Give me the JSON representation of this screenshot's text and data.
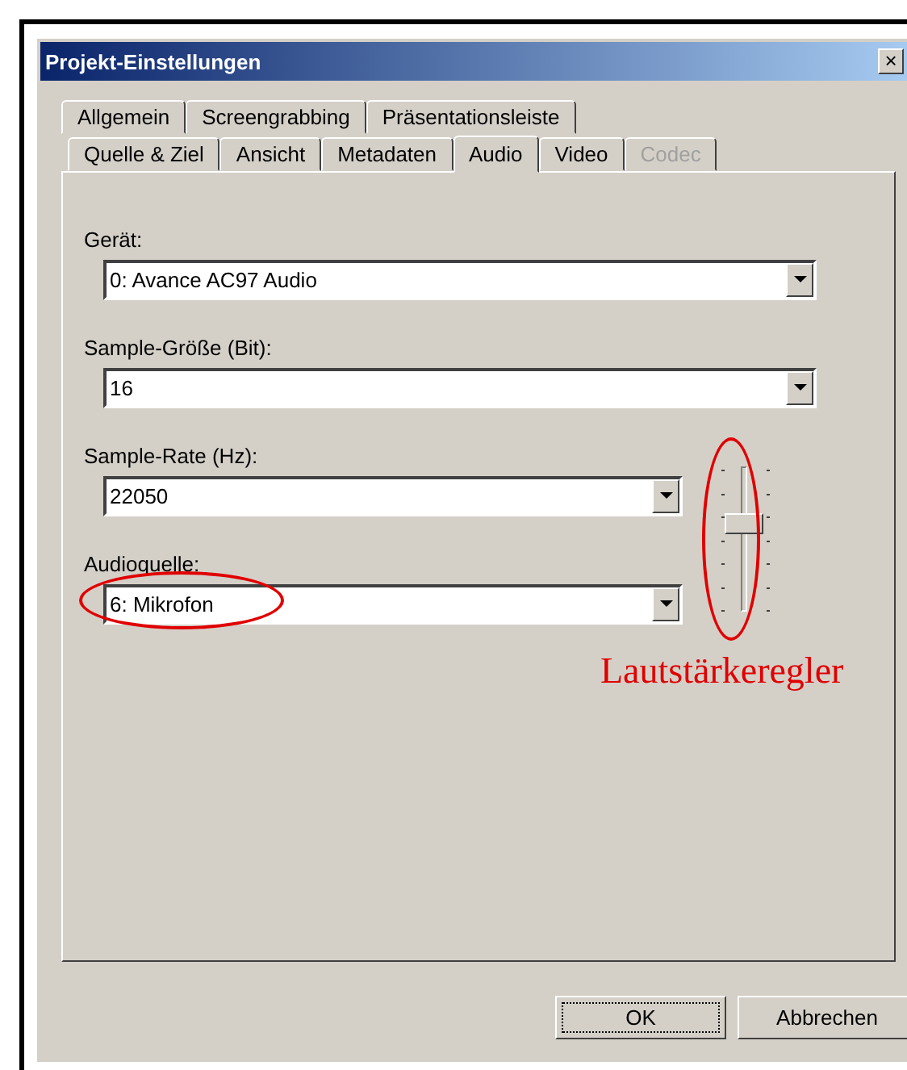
{
  "window": {
    "title": "Projekt-Einstellungen",
    "close": "×"
  },
  "tab_rows": [
    {
      "tabs": [
        {
          "label": "Allgemein",
          "selected": false,
          "disabled": false
        },
        {
          "label": "Screengrabbing",
          "selected": false,
          "disabled": false
        },
        {
          "label": "Präsentationsleiste",
          "selected": false,
          "disabled": false
        }
      ]
    },
    {
      "tabs": [
        {
          "label": "Quelle & Ziel",
          "selected": false,
          "disabled": false
        },
        {
          "label": "Ansicht",
          "selected": false,
          "disabled": false
        },
        {
          "label": "Metadaten",
          "selected": false,
          "disabled": false
        },
        {
          "label": "Audio",
          "selected": true,
          "disabled": false
        },
        {
          "label": "Video",
          "selected": false,
          "disabled": false
        },
        {
          "label": "Codec",
          "selected": false,
          "disabled": true
        }
      ]
    }
  ],
  "fields": [
    {
      "label": "Gerät:",
      "value": "0: Avance AC97 Audio",
      "kind": "wide",
      "highlighted": false
    },
    {
      "label": "Sample-Größe (Bit):",
      "value": "16",
      "kind": "wide",
      "highlighted": false
    },
    {
      "label": "Sample-Rate (Hz):",
      "value": "22050",
      "kind": "narrow",
      "highlighted": false
    },
    {
      "label": "Audioquelle:",
      "value": "6: Mikrofon",
      "kind": "narrow",
      "highlighted": true
    }
  ],
  "volume_slider": {
    "level": 0.6,
    "highlighted": true
  },
  "annotation": "Lautstärkeregler",
  "buttons": [
    {
      "label": "OK",
      "focused": true
    },
    {
      "label": "Abbrechen",
      "focused": false
    }
  ]
}
